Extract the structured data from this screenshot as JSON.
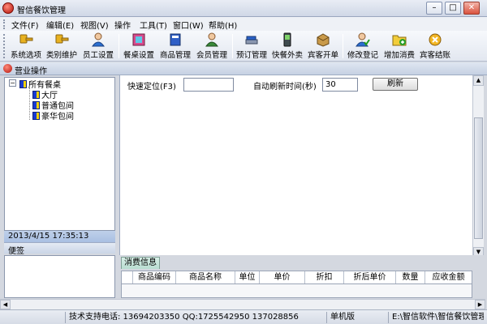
{
  "window": {
    "title": "智信餐饮管理",
    "buttons": {
      "minimize": "–",
      "maximize": "□",
      "close": "✕"
    }
  },
  "menu": [
    "文件(F)",
    "编辑(E)",
    "视图(V)",
    "操作",
    "工具(T)",
    "窗口(W)",
    "帮助(H)"
  ],
  "toolbar": [
    {
      "label": "系统选项",
      "icon": "key-icon"
    },
    {
      "label": "类别维护",
      "icon": "key-icon"
    },
    {
      "label": "员工设置",
      "icon": "person-icon"
    },
    {
      "label": "餐桌设置",
      "icon": "table-icon"
    },
    {
      "label": "商品管理",
      "icon": "book-icon"
    },
    {
      "label": "会员管理",
      "icon": "person-icon"
    },
    {
      "label": "预订管理",
      "icon": "stapler-icon"
    },
    {
      "label": "快餐外卖",
      "icon": "phone-icon"
    },
    {
      "label": "宾客开单",
      "icon": "box-icon"
    },
    {
      "label": "修改登记",
      "icon": "person-check-icon"
    },
    {
      "label": "增加消费",
      "icon": "folder-add-icon"
    },
    {
      "label": "宾客结账",
      "icon": "coin-icon"
    }
  ],
  "panel_title": "营业操作",
  "tree": {
    "root": "所有餐桌",
    "children": [
      "大厅",
      "普通包间",
      "豪华包间"
    ]
  },
  "datetime": "2013/4/15 17:35:13",
  "notes_label": "便签",
  "quick_locate": {
    "label": "快速定位(F3)",
    "value": ""
  },
  "auto_refresh": {
    "label": "自动刷新时间(秒)",
    "value": "30"
  },
  "refresh_button": "刷新",
  "tab": "消费信息",
  "columns": [
    "商品编码",
    "商品名称",
    "单位",
    "单价",
    "折扣",
    "折后单价",
    "数量",
    "应收金额"
  ],
  "status": {
    "support": "技术支持电话: 13694203350 QQ:1725542950 137028856",
    "edition": "单机版",
    "path": "E:\\智信软件\\智信餐饮管理"
  },
  "colors": {
    "accent_blue": "#1a3bd1",
    "title_red": "#b3120a",
    "tab_green": "#b9ddd1"
  }
}
